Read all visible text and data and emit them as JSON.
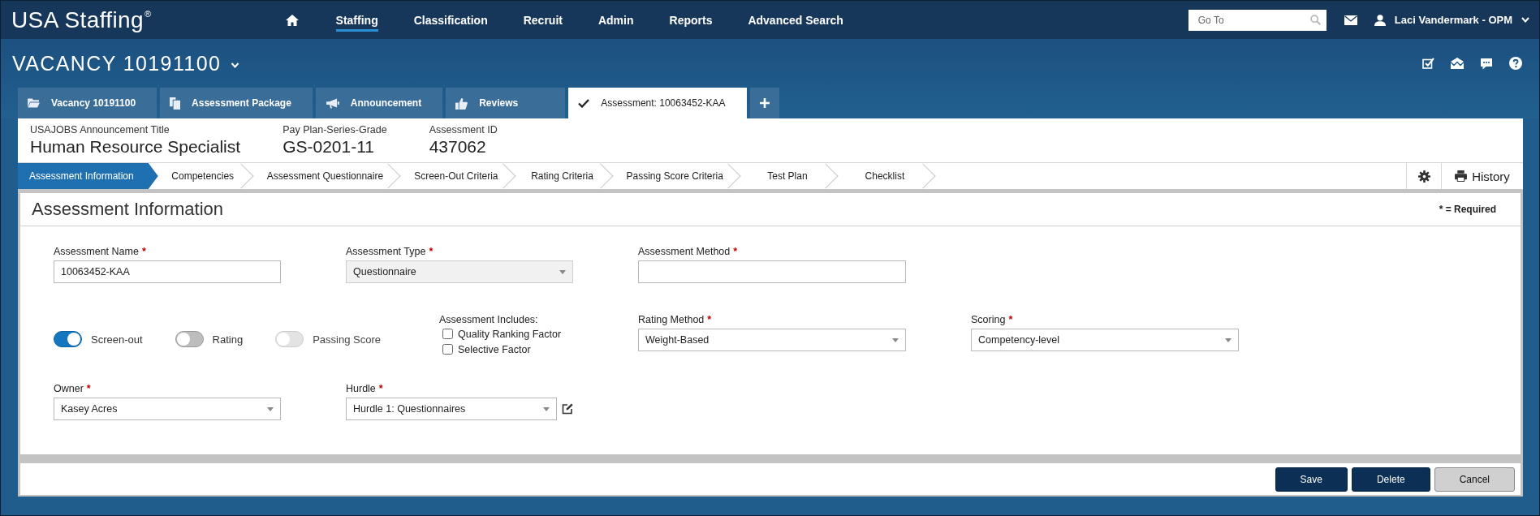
{
  "top_nav": {
    "logo": "USA Staffing$^{®}$",
    "items": [
      {
        "label": "Staffing",
        "selected": true
      },
      {
        "label": "Classification",
        "selected": false
      },
      {
        "label": "Recruit",
        "selected": false
      },
      {
        "label": "Admin",
        "selected": false
      },
      {
        "label": "Reports",
        "selected": false
      },
      {
        "label": "Advanced Search",
        "selected": false
      }
    ],
    "search": {
      "placeholder": "Go To"
    },
    "user": {
      "name": "Laci Vandermark - OPM"
    }
  },
  "vacancy": {
    "title": "VACANCY 10191100"
  },
  "tabs": [
    {
      "label": "Vacancy 10191100",
      "selected": false
    },
    {
      "label": "Assessment Package",
      "selected": false
    },
    {
      "label": "Announcement",
      "selected": false
    },
    {
      "label": "Reviews",
      "selected": false
    },
    {
      "label": "Assessment: 10063452-KAA",
      "selected": true
    }
  ],
  "summary": [
    {
      "label": "USAJOBS Announcement Title",
      "value": "Human Resource Specialist"
    },
    {
      "label": "Pay Plan-Series-Grade",
      "value": "GS-0201-11"
    },
    {
      "label": "Assessment ID",
      "value": "437062"
    }
  ],
  "steps": [
    {
      "label": "Assessment Information",
      "selected": true
    },
    {
      "label": "Competencies",
      "selected": false
    },
    {
      "label": "Assessment Questionnaire",
      "selected": false
    },
    {
      "label": "Screen-Out Criteria",
      "selected": false
    },
    {
      "label": "Rating Criteria",
      "selected": false
    },
    {
      "label": "Passing Score Criteria",
      "selected": false
    },
    {
      "label": "Test Plan",
      "selected": false
    },
    {
      "label": "Checklist",
      "selected": false
    }
  ],
  "step_actions": {
    "history": "History"
  },
  "panel": {
    "title": "Assessment Information",
    "required_note": "* = Required"
  },
  "form": {
    "row_1": [
      {
        "kind": "text",
        "label": "Assessment Name",
        "required_mark": "*",
        "value": "10063452-KAA",
        "disabled": false
      },
      {
        "kind": "select",
        "label": "Assessment Type",
        "required_mark": "*",
        "value": "Questionnaire",
        "disabled": true
      },
      {
        "kind": "text",
        "label": "Assessment Method",
        "required_mark": "*",
        "disabled": false
      }
    ],
    "toggles": [
      {
        "label": "Screen-out",
        "on": true,
        "disabled": false
      },
      {
        "label": "Rating",
        "on": false,
        "disabled": false
      },
      {
        "label": "Passing Score",
        "on": false,
        "disabled": true
      }
    ],
    "includes": {
      "label": "Assessment Includes:",
      "options": [
        {
          "label": "Quality Ranking Factor",
          "checked": false
        },
        {
          "label": "Selective Factor",
          "checked": false
        }
      ]
    },
    "row_2": [
      {
        "kind": "select",
        "label": "Rating Method",
        "required_mark": "*",
        "value": "Weight-Based",
        "disabled": false
      },
      {
        "kind": "select",
        "label": "Scoring",
        "required_mark": "*",
        "value": "Competency-level",
        "disabled": false
      }
    ],
    "row_3": [
      {
        "kind": "select",
        "label": "Owner",
        "required_mark": "*",
        "value": "Kasey Acres",
        "disabled": false
      },
      {
        "kind": "select",
        "label": "Hurdle",
        "required_mark": "*",
        "value": "Hurdle 1: Questionnaires",
        "disabled": false,
        "edit_button": true
      }
    ]
  },
  "footer_buttons": [
    {
      "label": "Save",
      "kind": "primary"
    },
    {
      "label": "Delete",
      "kind": "primary"
    },
    {
      "label": "Cancel",
      "kind": "secondary"
    }
  ]
}
